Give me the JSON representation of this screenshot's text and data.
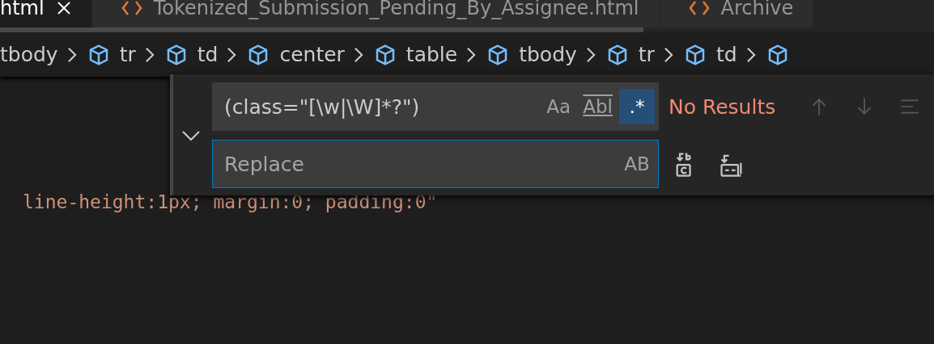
{
  "tabs": [
    {
      "label": "html",
      "selected": true,
      "closable": true
    },
    {
      "label": "Tokenized_Submission_Pending_By_Assignee.html",
      "selected": false,
      "closable": false
    },
    {
      "label": "Archive",
      "selected": false,
      "closable": false
    }
  ],
  "breadcrumbs": [
    "tbody",
    "tr",
    "td",
    "center",
    "table",
    "tbody",
    "tr",
    "td"
  ],
  "find_widget": {
    "expanded": true,
    "search_value": "(class=\"[\\w|\\W]*?\")",
    "search_options": [
      {
        "label": "Aa",
        "kind": "case",
        "selected": false
      },
      {
        "label": "Abl",
        "kind": "word",
        "selected": false
      },
      {
        "label": ".*",
        "kind": "regex",
        "selected": true
      }
    ],
    "status": "No Results",
    "nav": [
      {
        "kind": "up",
        "disabled": true
      },
      {
        "kind": "down",
        "disabled": true
      },
      {
        "kind": "selection",
        "disabled": true
      }
    ],
    "replace_placeholder": "Replace",
    "replace_options": [
      {
        "label": "AB",
        "selected": false
      }
    ],
    "replace_actions": [
      {
        "kind": "one"
      },
      {
        "kind": "all"
      }
    ]
  },
  "code_line": "line-height:1px; margin:0; padding:0\""
}
